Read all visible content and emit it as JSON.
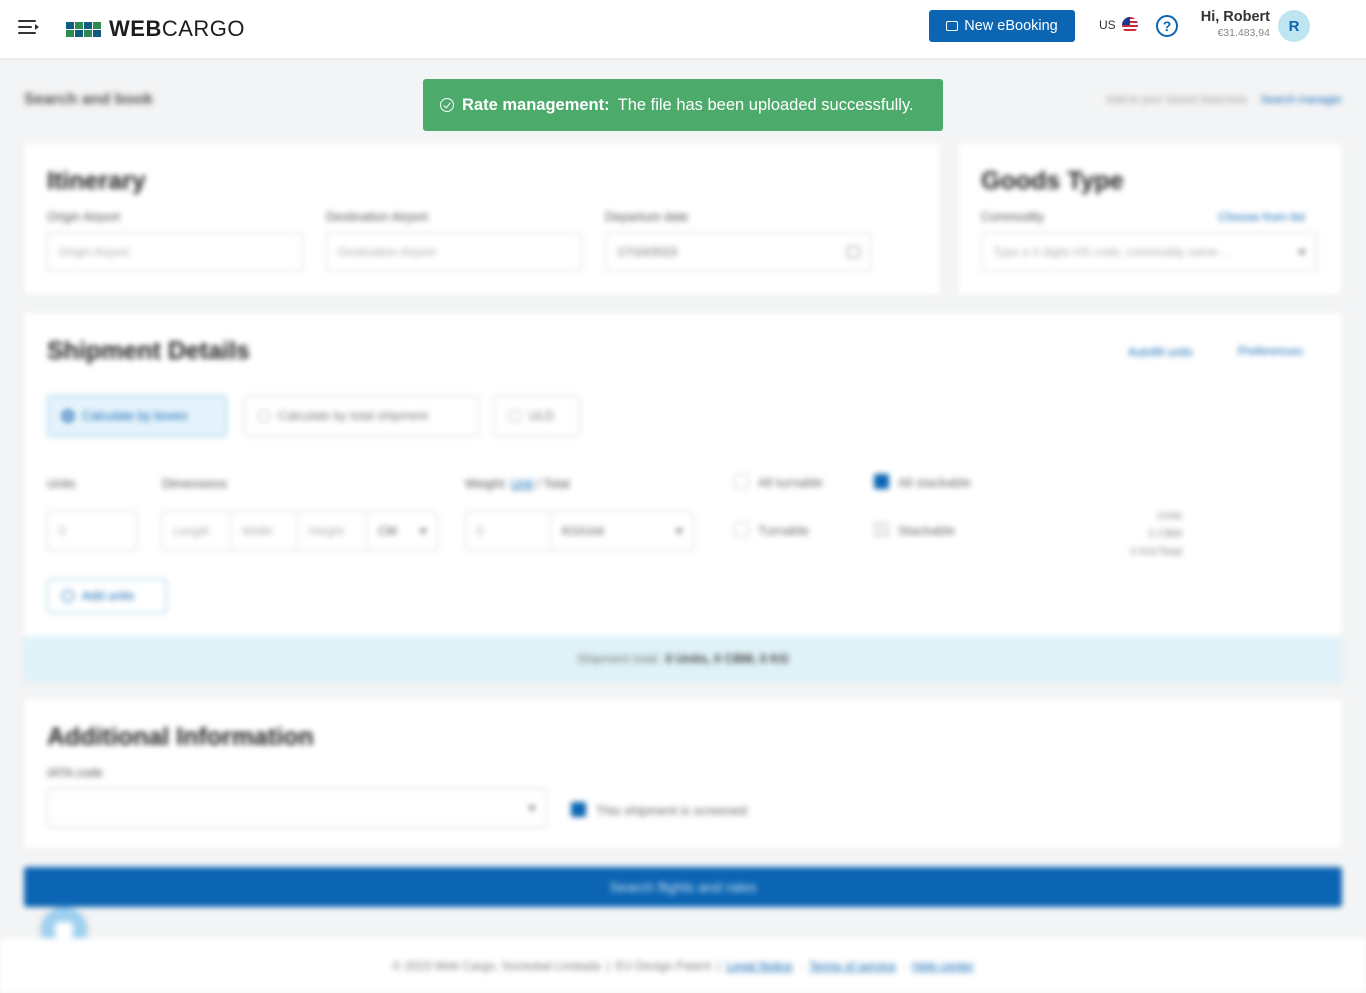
{
  "header": {
    "logo_web": "WEB",
    "logo_cargo": "CARGO",
    "new_ebooking": "New eBooking",
    "language": "US",
    "help_icon": "?",
    "greeting": "Hi, Robert",
    "balance": "€31.483,94",
    "avatar_initial": "R"
  },
  "toast": {
    "title": "Rate management:",
    "message": "The file has been uploaded successfully."
  },
  "page": {
    "title": "Search and book",
    "saved_search": "Add to your Saved Searches",
    "search_manager": "Search manager"
  },
  "itinerary": {
    "title": "Itinerary",
    "origin_label": "Origin Airport",
    "origin_placeholder": "Origin Airport",
    "destination_label": "Destination Airport",
    "destination_placeholder": "Destination Airport",
    "departure_label": "Departure date",
    "departure_value": "17/10/2023"
  },
  "goods": {
    "title": "Goods Type",
    "commodity_label": "Commodity",
    "choose_link": "Choose from list",
    "commodity_placeholder": "Type a 4 digits HS code, commodity name ..."
  },
  "shipment": {
    "title": "Shipment Details",
    "autofill": "Autofill units",
    "preferences": "Preferences",
    "options": [
      "Calculate by boxes",
      "Calculate by total shipment",
      "ULD"
    ],
    "units_label": "Units",
    "dimensions_label": "Dimensions",
    "weight_label": "Weight:",
    "weight_unit_link": "Unit",
    "weight_total": "Total",
    "units_value": "0",
    "length_ph": "Length",
    "width_ph": "Width",
    "height_ph": "Height",
    "dim_unit": "CM",
    "weight_value": "0",
    "weight_unit": "KG/Unit",
    "all_turnable": "All turnable",
    "all_stackable": "All stackable",
    "turnable": "Turnable",
    "stackable": "Stackable",
    "summary_units": "Units",
    "summary_cbm": "0 CBM",
    "summary_kg": "0 KG/Total",
    "add_units": "Add units",
    "total_prefix": "Shipment total:",
    "total_value": "0 Units, 0 CBM, 0 KG"
  },
  "additional": {
    "title": "Additional Information",
    "iata_label": "IATA code",
    "screened": "This shipment is screened"
  },
  "actions": {
    "search": "Search flights and rates"
  },
  "footer": {
    "copyright": "© 2023 Web Cargo, Sociedad Limitada",
    "patent": "EU Design Patent",
    "legal": "Legal Notice",
    "terms": "Terms of service",
    "help": "Help center"
  }
}
